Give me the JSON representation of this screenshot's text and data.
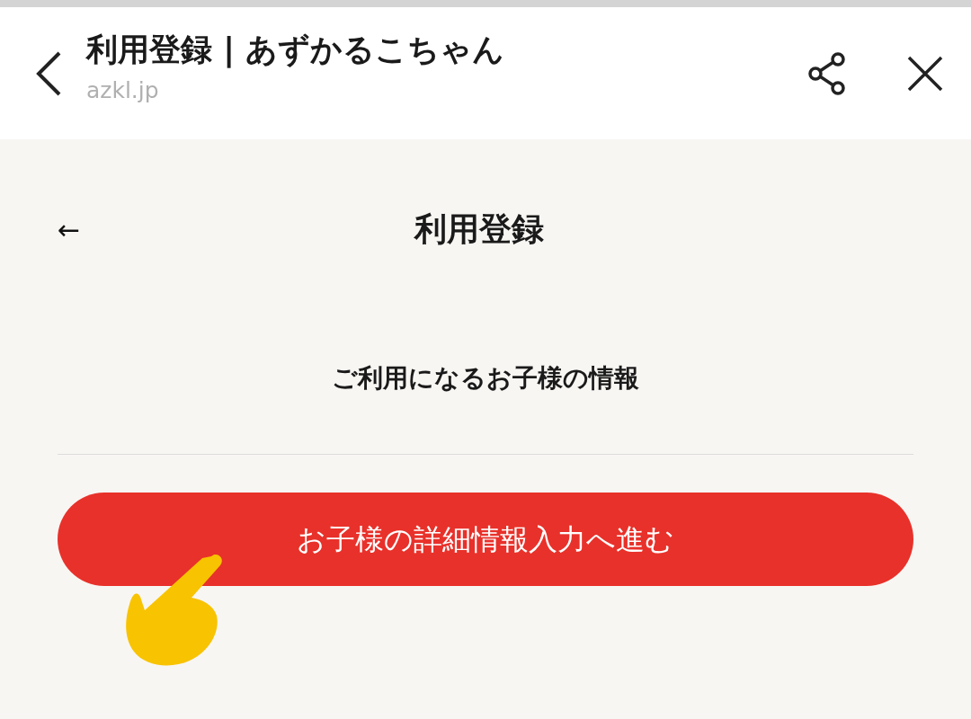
{
  "browser_bar": {
    "title": "利用登録 | あずかるこちゃん",
    "url": "azkl.jp"
  },
  "page": {
    "back_arrow": "←",
    "title": "利用登録",
    "section_title": "ご利用になるお子様の情報"
  },
  "button": {
    "label": "お子様の詳細情報入力へ進む"
  }
}
